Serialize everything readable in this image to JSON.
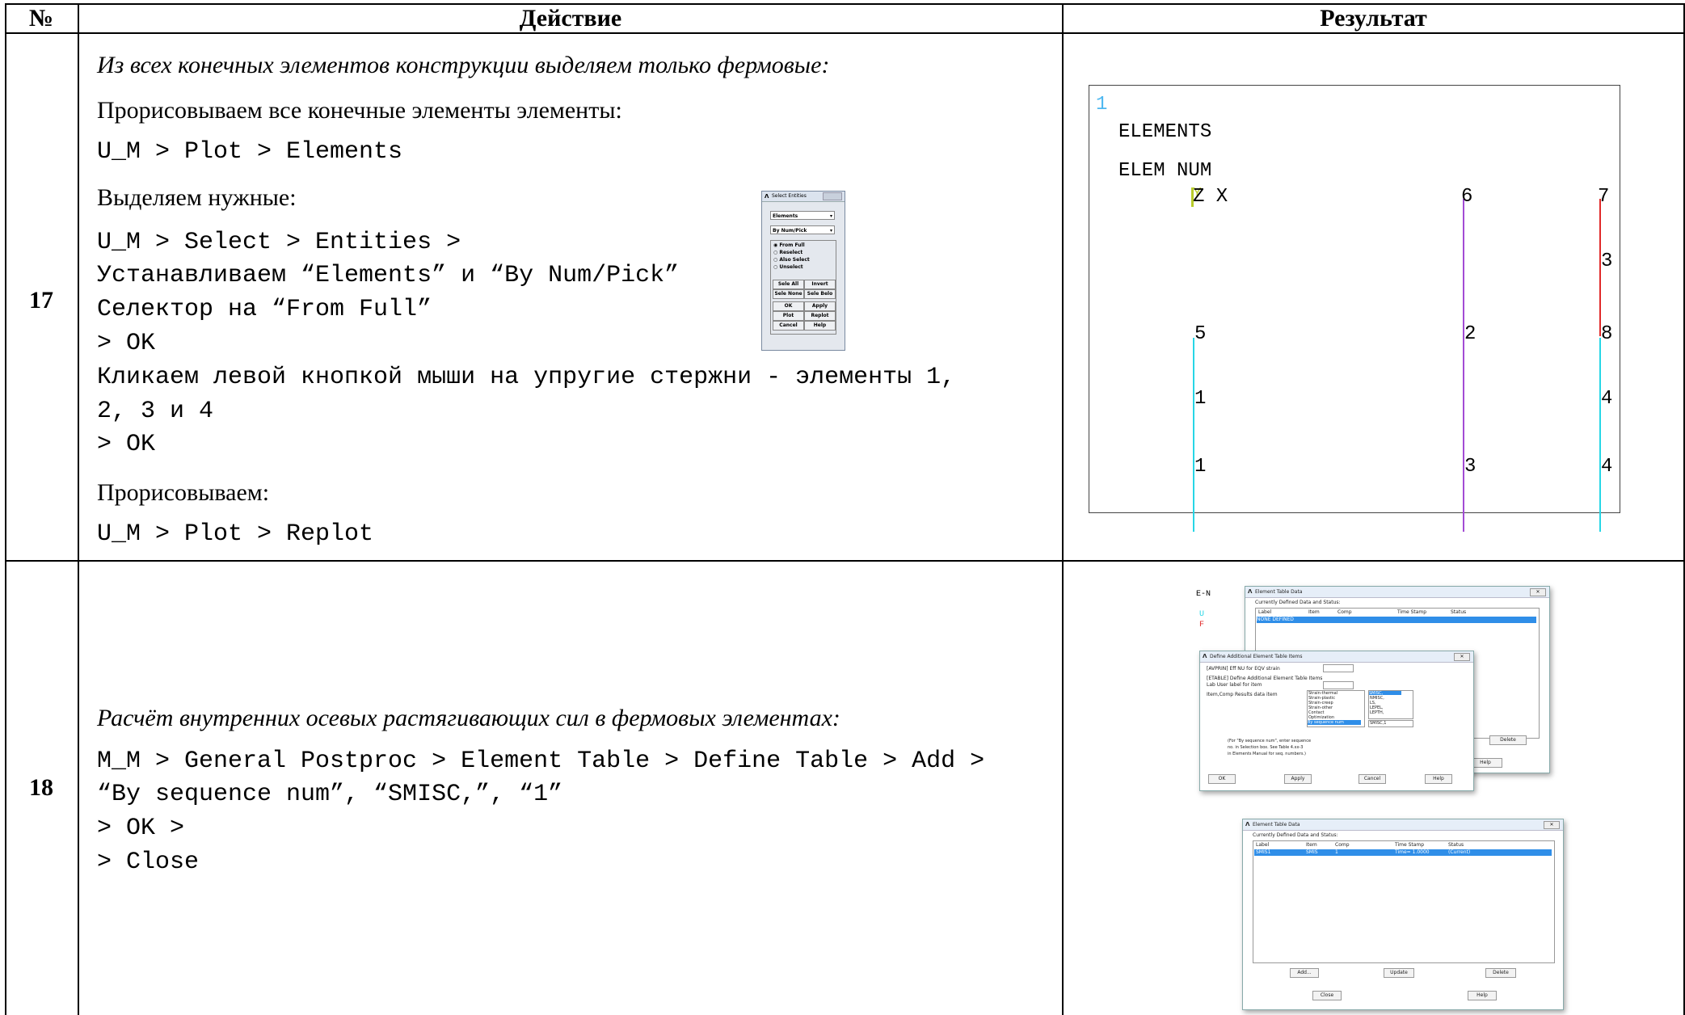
{
  "header": {
    "num": "№",
    "action": "Действие",
    "result": "Результат"
  },
  "row17": {
    "num": "17",
    "lines": [
      "Из всех конечных элементов конструкции выделяем только фермовые:",
      "Прорисовываем все конечные элементы элементы:",
      "U_M > Plot > Elements",
      "Выделяем нужные:",
      "U_M > Select > Entities >",
      "Устанавливаем “Elements” и “By Num/Pick”",
      "Селектор на “From Full”",
      "> OK",
      "Кликаем левой кнопкой мыши на упругие стержни - элементы 1,",
      "2, 3 и 4",
      "> OK",
      "Прорисовываем:",
      "U_M > Plot > Replot"
    ],
    "select_dialog": {
      "title": "Select Entities",
      "entity": "Elements",
      "method": "By Num/Pick",
      "radios": [
        "From Full",
        "Reselect",
        "Also Select",
        "Unselect"
      ],
      "buttons": [
        "Sele All",
        "Invert",
        "Sele None",
        "Sele Belo",
        "OK",
        "Apply",
        "Plot",
        "Replot",
        "Cancel",
        "Help"
      ]
    },
    "plot": {
      "window_num": "1",
      "title1": "ELEMENTS",
      "title2": "ELEM NUM",
      "triad": "Z X",
      "triad_y": "Y",
      "labels": [
        "6",
        "7",
        "3",
        "5",
        "2",
        "8",
        "1",
        "4",
        "1",
        "3",
        "4"
      ],
      "colors": {
        "cyan": "#27d6e6",
        "purple": "#a24bd4",
        "red": "#e02a2a",
        "window": "#4fb8f0"
      }
    }
  },
  "row18": {
    "num": "18",
    "lines": [
      "Расчёт внутренних осевых растягивающих сил в фермовых элементах:",
      "M_M > General Postproc > Element Table > Define Table > Add >",
      "“By sequence num”, “SMISC,”, “1”",
      "> OK >",
      "> Close"
    ],
    "screens": {
      "bg_labels": [
        "E-N",
        "U",
        "F"
      ],
      "etd1": {
        "title": "Element Table Data",
        "subtitle": "Currently Defined Data and Status:",
        "cols": [
          "Label",
          "Item",
          "Comp",
          "Time Stamp",
          "Status"
        ],
        "row": "NONE DEFINED",
        "buttons": [
          "Delete",
          "Help"
        ]
      },
      "define": {
        "title": "Define Additional Element Table Items",
        "l1": "[AVPRIN]  Eff NU for EQV strain",
        "l2": "[ETABLE]  Define Additional Element Table Items",
        "l3": "Lab     User label for item",
        "l4": "Item,Comp  Results data item",
        "left_list": [
          "Strain-thermal",
          "Strain-plastic",
          "Strain-creep",
          "Strain-other",
          "Contact",
          "Optimization",
          "By sequence num"
        ],
        "right_list": [
          "SMISC,",
          "NMISC,",
          "LS,",
          "LEPEL,",
          "LEPTH,"
        ],
        "value": "SMISC,1",
        "note": [
          "(For \"By sequence num\", enter sequence",
          "no. in Selection box.  See Table 4.xx-3",
          "in Elements Manual for seq. numbers.)"
        ],
        "buttons": [
          "OK",
          "Apply",
          "Cancel",
          "Help"
        ]
      },
      "etd2": {
        "title": "Element Table Data",
        "subtitle": "Currently Defined Data and Status:",
        "cols": [
          "Label",
          "Item",
          "Comp",
          "Time Stamp",
          "Status"
        ],
        "row": [
          "SMIS1",
          "SMIS",
          "1",
          "Time=  1.0000",
          "(Current)"
        ],
        "buttons": [
          "Add...",
          "Update",
          "Delete",
          "Close",
          "Help"
        ]
      }
    }
  }
}
